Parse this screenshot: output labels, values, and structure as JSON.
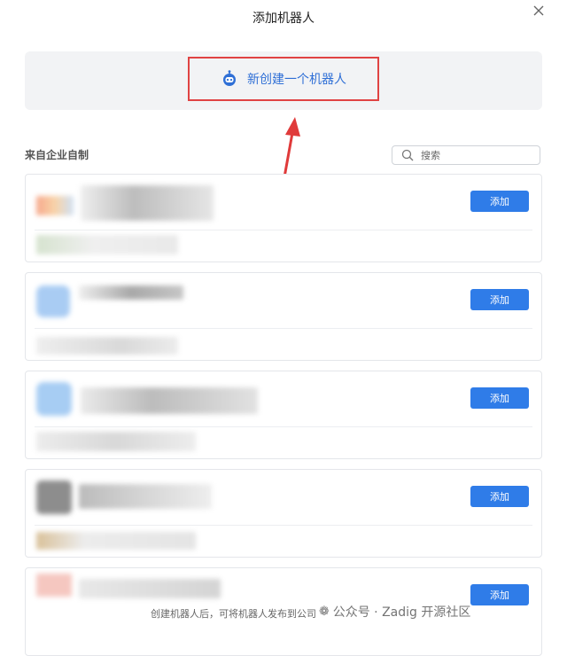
{
  "dialog": {
    "title": "添加机器人"
  },
  "create": {
    "label": "新创建一个机器人"
  },
  "section": {
    "title": "来自企业自制"
  },
  "search": {
    "placeholder": "搜索"
  },
  "cards": [
    {
      "button": "添加"
    },
    {
      "button": "添加"
    },
    {
      "button": "添加"
    },
    {
      "button": "添加"
    },
    {
      "button": "添加"
    }
  ],
  "footer": {
    "note": "创建机器人后，可将机器人发布到公司"
  },
  "watermark": {
    "text": "公众号 · Zadig 开源社区"
  },
  "colors": {
    "accent": "#2f7ce8",
    "highlight_border": "#e04343",
    "panel_bg": "#f2f3f5"
  }
}
